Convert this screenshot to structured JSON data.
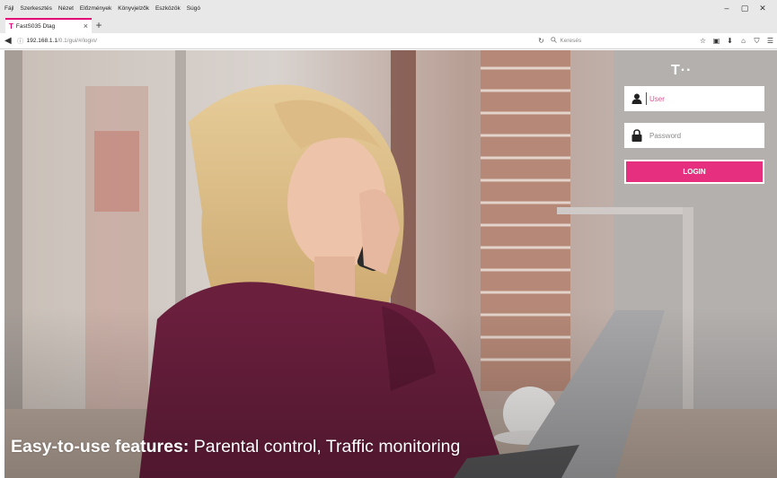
{
  "browser": {
    "menu": [
      "Fájl",
      "Szerkesztés",
      "Nézet",
      "Előzmények",
      "Könyvjelzők",
      "Eszközök",
      "Súgó"
    ],
    "window_controls": [
      "–",
      "▢",
      "✕"
    ],
    "tab_title": "FastS035 Dtag",
    "tab_close": "×",
    "new_tab": "+",
    "url_host": "192.168.1.1",
    "url_path": "/0.1/gui/#/login/",
    "search_placeholder": "Keresés"
  },
  "login": {
    "brand_logo": "T··",
    "user_placeholder": "User",
    "password_placeholder": "Password",
    "login_label": "LOGIN",
    "accent_color": "#e6307f"
  },
  "banner": {
    "caption_bold": "Easy-to-use features:",
    "caption_rest": " Parental control, Traffic monitoring"
  }
}
